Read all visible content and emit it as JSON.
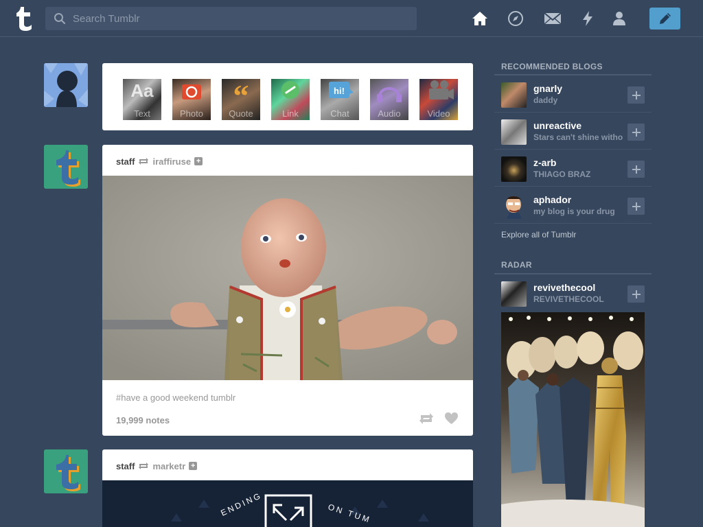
{
  "header": {
    "search_placeholder": "Search Tumblr",
    "nav_icons": [
      "home-icon",
      "explore-icon",
      "inbox-icon",
      "activity-icon",
      "account-icon"
    ],
    "compose_icon": "pencil-icon",
    "accent": "#529ecc",
    "bg": "#36465d"
  },
  "post_types": [
    {
      "label": "Text",
      "icon": "text-icon"
    },
    {
      "label": "Photo",
      "icon": "camera-icon"
    },
    {
      "label": "Quote",
      "icon": "quote-icon"
    },
    {
      "label": "Link",
      "icon": "link-icon"
    },
    {
      "label": "Chat",
      "icon": "chat-icon"
    },
    {
      "label": "Audio",
      "icon": "headphones-icon"
    },
    {
      "label": "Video",
      "icon": "video-camera-icon"
    }
  ],
  "posts": [
    {
      "user": "staff",
      "source": "iraffiruse",
      "tags": "#have a good weekend tumblr",
      "notes": "19,999 notes"
    },
    {
      "user": "staff",
      "source": "marketr",
      "banner_left": "ENDING",
      "banner_right": "ON TUM"
    }
  ],
  "sidebar": {
    "recommended_title": "RECOMMENDED BLOGS",
    "blogs": [
      {
        "name": "gnarly",
        "desc": "daddy"
      },
      {
        "name": "unreactive",
        "desc": "Stars can't shine without"
      },
      {
        "name": "z-arb",
        "desc": "THIAGO BRAZ"
      },
      {
        "name": "aphador",
        "desc": "my blog is your drug"
      }
    ],
    "explore": "Explore all of Tumblr",
    "radar_title": "RADAR",
    "radar": {
      "name": "revivethecool",
      "desc": "REVIVETHECOOL"
    }
  }
}
